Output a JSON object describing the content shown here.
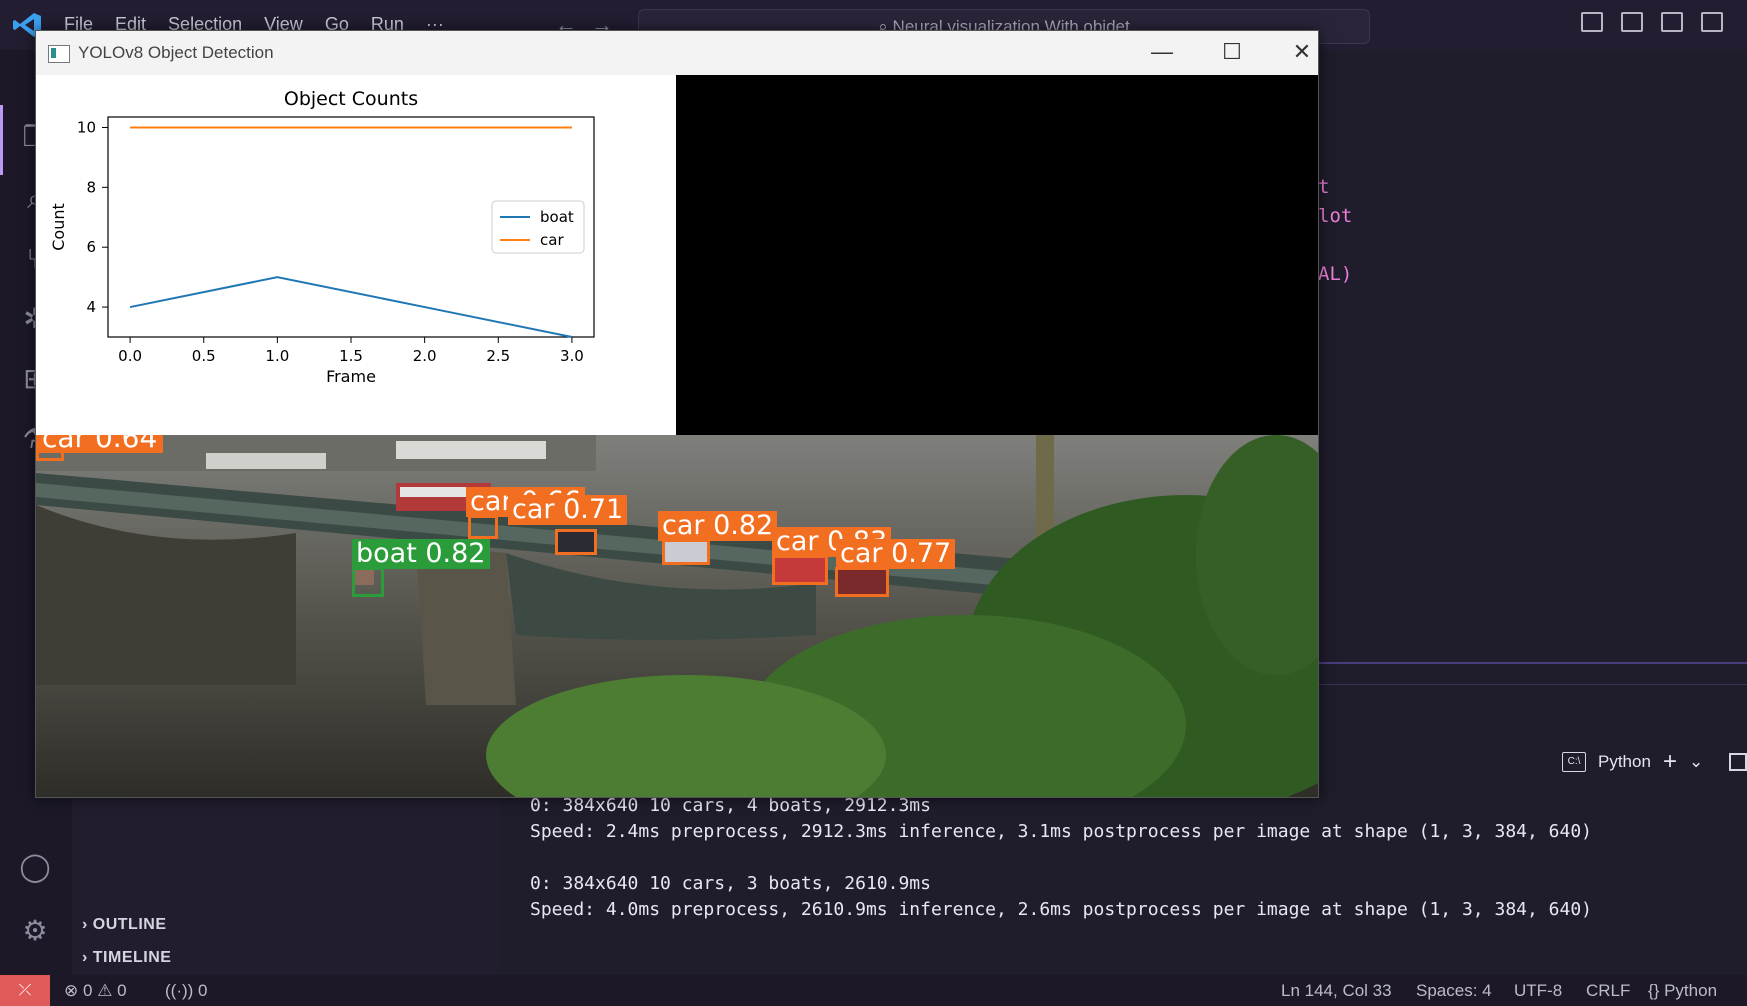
{
  "app": {
    "menu": [
      "File",
      "Edit",
      "Selection",
      "View",
      "Go",
      "Run",
      "···"
    ],
    "command_center": "Neural visualization With objdet"
  },
  "editor": {
    "code_fragments": [
      "t",
      "lot",
      "AL)"
    ]
  },
  "sidebar": {
    "sections": [
      "OUTLINE",
      "TIMELINE"
    ]
  },
  "terminal": {
    "profile_label": "Python",
    "lines": [
      "0: 384x640 10 cars, 4 boats, 2912.3ms",
      "Speed: 2.4ms preprocess, 2912.3ms inference, 3.1ms postprocess per image at shape (1, 3, 384, 640)",
      "",
      "0: 384x640 10 cars, 3 boats, 2610.9ms",
      "Speed: 4.0ms preprocess, 2610.9ms inference, 2.6ms postprocess per image at shape (1, 3, 384, 640)"
    ]
  },
  "statusbar": {
    "errors": "0",
    "warnings": "0",
    "ports": "0",
    "position": "Ln 144, Col 33",
    "spaces": "Spaces: 4",
    "encoding": "UTF-8",
    "eol": "CRLF",
    "language": "Python"
  },
  "cv_window": {
    "title": "YOLOv8 Object Detection",
    "detections": [
      {
        "label": "car 0.64",
        "cls": "car"
      },
      {
        "label": "car 0.66",
        "cls": "car"
      },
      {
        "label": "car 0.71",
        "cls": "car"
      },
      {
        "label": "car 0.82",
        "cls": "car"
      },
      {
        "label": "car 0.83",
        "cls": "car"
      },
      {
        "label": "car 0.77",
        "cls": "car"
      },
      {
        "label": "boat 0.82",
        "cls": "boat"
      }
    ]
  },
  "colors": {
    "boat_series": "#1f77b4",
    "car_series": "#ff7f0e",
    "car_box": "#f26f22",
    "boat_box": "#2a9d3a",
    "remote_badge": "#e05a5a"
  },
  "chart_data": {
    "type": "line",
    "title": "Object Counts",
    "xlabel": "Frame",
    "ylabel": "Count",
    "x": [
      0,
      1,
      2,
      3
    ],
    "xlim": [
      -0.15,
      3.15
    ],
    "ylim": [
      3.0,
      10.35
    ],
    "xticks": [
      "0.0",
      "0.5",
      "1.0",
      "1.5",
      "2.0",
      "2.5",
      "3.0"
    ],
    "yticks": [
      "4",
      "6",
      "8",
      "10"
    ],
    "legend_position": "center-right",
    "series": [
      {
        "name": "boat",
        "values": [
          4,
          5,
          4,
          3
        ]
      },
      {
        "name": "car",
        "values": [
          10,
          10,
          10,
          10
        ]
      }
    ]
  }
}
